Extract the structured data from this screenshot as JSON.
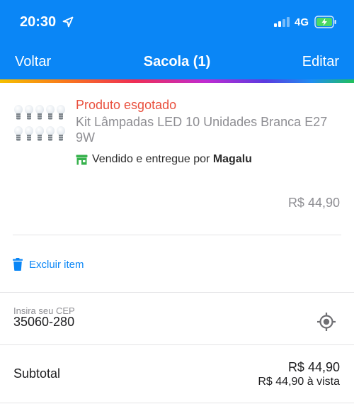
{
  "status_bar": {
    "time": "20:30",
    "network": "4G",
    "location_icon": "location-arrow-icon",
    "battery_icon": "battery-charging-icon"
  },
  "nav": {
    "back_label": "Voltar",
    "title": "Sacola (1)",
    "edit_label": "Editar"
  },
  "theme": {
    "brand_blue": "#0a86f6",
    "sold_out_red": "#e9503e",
    "seller_green": "#37b24d",
    "muted_gray": "#8e8e93"
  },
  "product": {
    "status": "Produto esgotado",
    "name": "Kit Lâmpadas LED 10 Unidades Branca E27 9W",
    "seller_prefix": "Vendido e entregue por ",
    "seller_name": "Magalu",
    "price": "R$ 44,90",
    "image_icon": "led-bulbs-image"
  },
  "actions": {
    "delete_label": "Excluir item",
    "delete_icon": "trash-icon"
  },
  "cep": {
    "label": "Insira seu CEP",
    "value": "35060-280",
    "locate_icon": "gps-target-icon"
  },
  "summary": {
    "subtotal_label": "Subtotal",
    "subtotal_price": "R$ 44,90",
    "cash_price": "R$ 44,90 à vista"
  }
}
